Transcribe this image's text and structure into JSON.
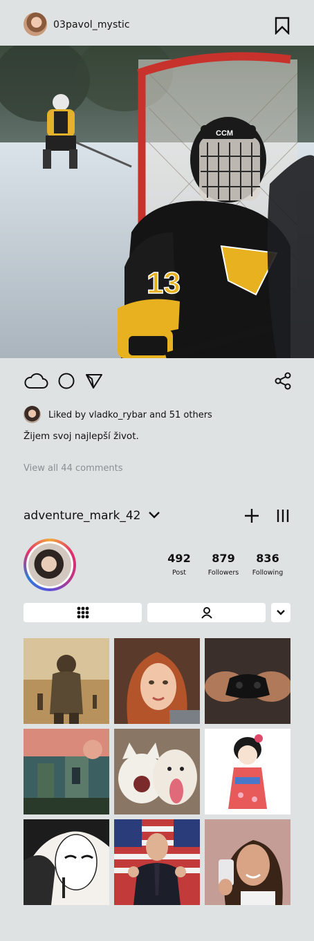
{
  "post": {
    "username": "03pavol_mystic",
    "liked_by_text": "Liked by vladko_rybar and 51 others",
    "caption": "Žijem svoj najlepší život.",
    "view_comments": "View all 44 comments",
    "jersey_number": "13",
    "helmet_brand": "CCM"
  },
  "profile": {
    "username": "adventure_mark_42",
    "stats": [
      {
        "value": "492",
        "label": "Post"
      },
      {
        "value": "879",
        "label": "Followers"
      },
      {
        "value": "836",
        "label": "Following"
      }
    ]
  },
  "icons": {
    "bookmark": "bookmark-icon",
    "like": "cloud-icon",
    "comment": "circle-icon",
    "send": "send-icon",
    "share": "share-icon",
    "add": "plus-icon",
    "menu": "menu-icon",
    "dropdown": "chevron-down-icon",
    "grid_tab": "grid-icon",
    "tagged_tab": "person-icon"
  },
  "grid": [
    "soldier",
    "redhead-selfie",
    "game-controller",
    "pixel-ruins",
    "cat-and-dog",
    "kimono-doll",
    "manga-girl",
    "businessman-flags",
    "girl-phone-selfie"
  ]
}
